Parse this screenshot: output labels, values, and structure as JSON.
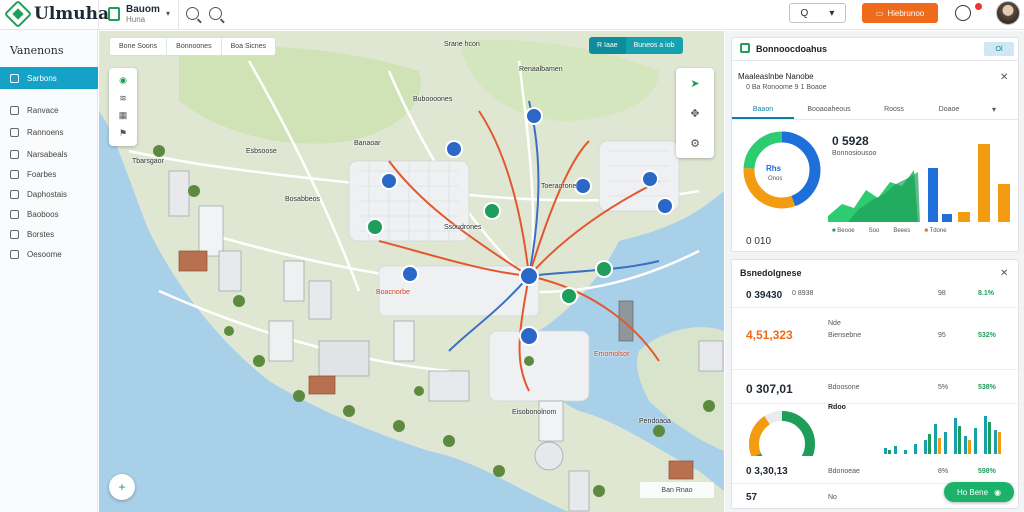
{
  "app": {
    "title": "Ulmuha"
  },
  "workspace": {
    "name": "Bauom",
    "sub": "Huna"
  },
  "toolbar": {
    "search_label": "Q",
    "cta_label": "Hiebrunoo"
  },
  "sidebar": {
    "title": "Vanenons",
    "items": [
      {
        "label": "Sarbons"
      },
      {
        "label": "Ranvace"
      },
      {
        "label": "Rannoens"
      },
      {
        "label": "Narsabeals"
      },
      {
        "label": "Foarbes"
      },
      {
        "label": "Daphostais"
      },
      {
        "label": "Baoboos"
      },
      {
        "label": "Borstes"
      },
      {
        "label": "Oesoome"
      }
    ]
  },
  "map": {
    "tabs": [
      "Bone Soons",
      "Bonnoones",
      "Boa Sicnes"
    ],
    "toggle": [
      "R Iaae",
      "Buneos a iob"
    ],
    "scale": "Ban Rnao",
    "labels": [
      {
        "text": "Srane hcon",
        "red": false
      },
      {
        "text": "Renaalbamen",
        "red": false
      },
      {
        "text": "Buboooones",
        "red": false
      },
      {
        "text": "Esbsoose",
        "red": false
      },
      {
        "text": "Banaoar",
        "red": false
      },
      {
        "text": "Bosabbeos",
        "red": false
      },
      {
        "text": "Toeraorone",
        "red": false
      },
      {
        "text": "Ssoudrones",
        "red": false
      },
      {
        "text": "Tbarsgaor",
        "red": false
      },
      {
        "text": "Boacnorbe",
        "red": true
      },
      {
        "text": "Emomolsor",
        "red": true
      },
      {
        "text": "Eisobonolnom",
        "red": false
      },
      {
        "text": "Pendoaoa",
        "red": false
      }
    ]
  },
  "panel1": {
    "title": "Bonnoocdoahus",
    "badge": "Ol",
    "sub_title": "Maaleaslnbe Nanobe",
    "sub_meta": "0 Ba Ronoome 9 1 Boaoe",
    "tabs": [
      "Baaon",
      "Booaoaheous",
      "Rooss",
      "Doaoe"
    ],
    "donut_label": "Rhs",
    "donut_value": "Onos",
    "stat_value": "0 5928",
    "stat_label": "Bonnosiousoo",
    "legend": [
      {
        "label": "Beooe"
      },
      {
        "label": "Soo"
      },
      {
        "label": "Beees"
      },
      {
        "label": "Tdone"
      }
    ],
    "footer": "0 010",
    "colors": [
      "#1e6fd9",
      "#f39c12",
      "#2ecc71",
      "#1e9e5a"
    ]
  },
  "panel2": {
    "title": "Bsnedolgnese",
    "rows": [
      {
        "a": "0 39430",
        "b": "0 8938",
        "c": "98",
        "d": "8.1%"
      },
      {
        "a": "4,51,323",
        "b": "Nde",
        "c": "95",
        "d": "532%"
      },
      {
        "a": "0 307,01",
        "b": "Bdoosone",
        "c": "5%",
        "d": "538%"
      },
      {
        "a": "0 3,30,13",
        "b": "Bdonoeae",
        "c": "8%",
        "d": "598%"
      }
    ],
    "row_sub": "Biensebne",
    "gauge_value": "Rdoo",
    "footer_a": "57",
    "footer_b": "No",
    "fab_label": "Ho Bene"
  }
}
